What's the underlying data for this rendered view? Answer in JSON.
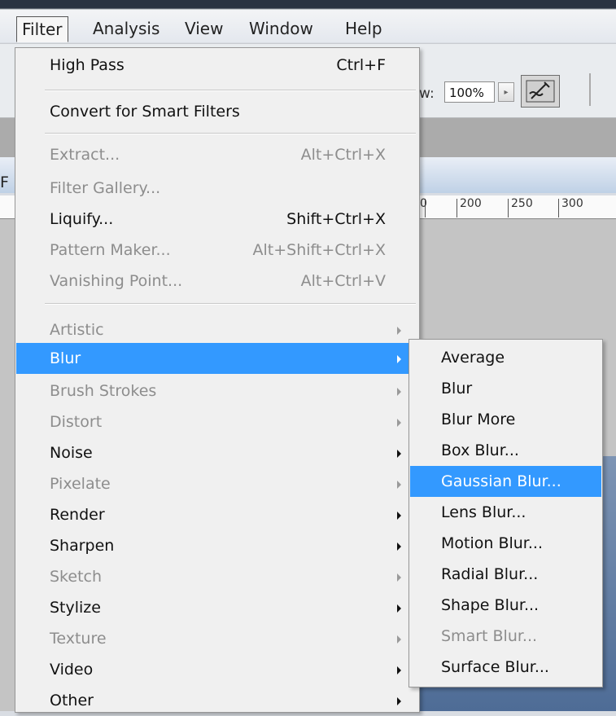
{
  "menubar": {
    "items": [
      {
        "label": "Filter",
        "active": true
      },
      {
        "label": "Analysis"
      },
      {
        "label": "View"
      },
      {
        "label": "Window"
      },
      {
        "label": "Help"
      }
    ]
  },
  "options_bar": {
    "label_fragment": "w:",
    "zoom_value": "100%",
    "arrow_icon": "triangle-right",
    "airbrush_icon": "airbrush-icon"
  },
  "document": {
    "edge_char": "F",
    "ruler_labels": [
      "0",
      "200",
      "250",
      "300"
    ]
  },
  "filter_menu": {
    "items": [
      {
        "label": "High Pass",
        "shortcut": "Ctrl+F",
        "disabled": false
      },
      {
        "label": "Convert for Smart Filters",
        "shortcut": "",
        "disabled": false
      },
      {
        "label": "Extract...",
        "shortcut": "Alt+Ctrl+X",
        "disabled": true
      },
      {
        "label": "Filter Gallery...",
        "shortcut": "",
        "disabled": true
      },
      {
        "label": "Liquify...",
        "shortcut": "Shift+Ctrl+X",
        "disabled": false
      },
      {
        "label": "Pattern Maker...",
        "shortcut": "Alt+Shift+Ctrl+X",
        "disabled": true
      },
      {
        "label": "Vanishing Point...",
        "shortcut": "Alt+Ctrl+V",
        "disabled": true
      },
      {
        "label": "Artistic",
        "submenu": true,
        "disabled": true
      },
      {
        "label": "Blur",
        "submenu": true,
        "disabled": false,
        "selected": true
      },
      {
        "label": "Brush Strokes",
        "submenu": true,
        "disabled": true
      },
      {
        "label": "Distort",
        "submenu": true,
        "disabled": true
      },
      {
        "label": "Noise",
        "submenu": true,
        "disabled": false
      },
      {
        "label": "Pixelate",
        "submenu": true,
        "disabled": true
      },
      {
        "label": "Render",
        "submenu": true,
        "disabled": false
      },
      {
        "label": "Sharpen",
        "submenu": true,
        "disabled": false
      },
      {
        "label": "Sketch",
        "submenu": true,
        "disabled": true
      },
      {
        "label": "Stylize",
        "submenu": true,
        "disabled": false
      },
      {
        "label": "Texture",
        "submenu": true,
        "disabled": true
      },
      {
        "label": "Video",
        "submenu": true,
        "disabled": false
      },
      {
        "label": "Other",
        "submenu": true,
        "disabled": false
      }
    ]
  },
  "blur_submenu": {
    "items": [
      {
        "label": "Average",
        "disabled": false
      },
      {
        "label": "Blur",
        "disabled": false
      },
      {
        "label": "Blur More",
        "disabled": false
      },
      {
        "label": "Box Blur...",
        "disabled": false
      },
      {
        "label": "Gaussian Blur...",
        "disabled": false,
        "selected": true
      },
      {
        "label": "Lens Blur...",
        "disabled": false
      },
      {
        "label": "Motion Blur...",
        "disabled": false
      },
      {
        "label": "Radial Blur...",
        "disabled": false
      },
      {
        "label": "Shape Blur...",
        "disabled": false
      },
      {
        "label": "Smart Blur...",
        "disabled": true
      },
      {
        "label": "Surface Blur...",
        "disabled": false
      }
    ]
  },
  "colors": {
    "highlight": "#3399ff",
    "disabled_text": "#8d8d8d",
    "menu_bg": "#f0f0f0"
  }
}
